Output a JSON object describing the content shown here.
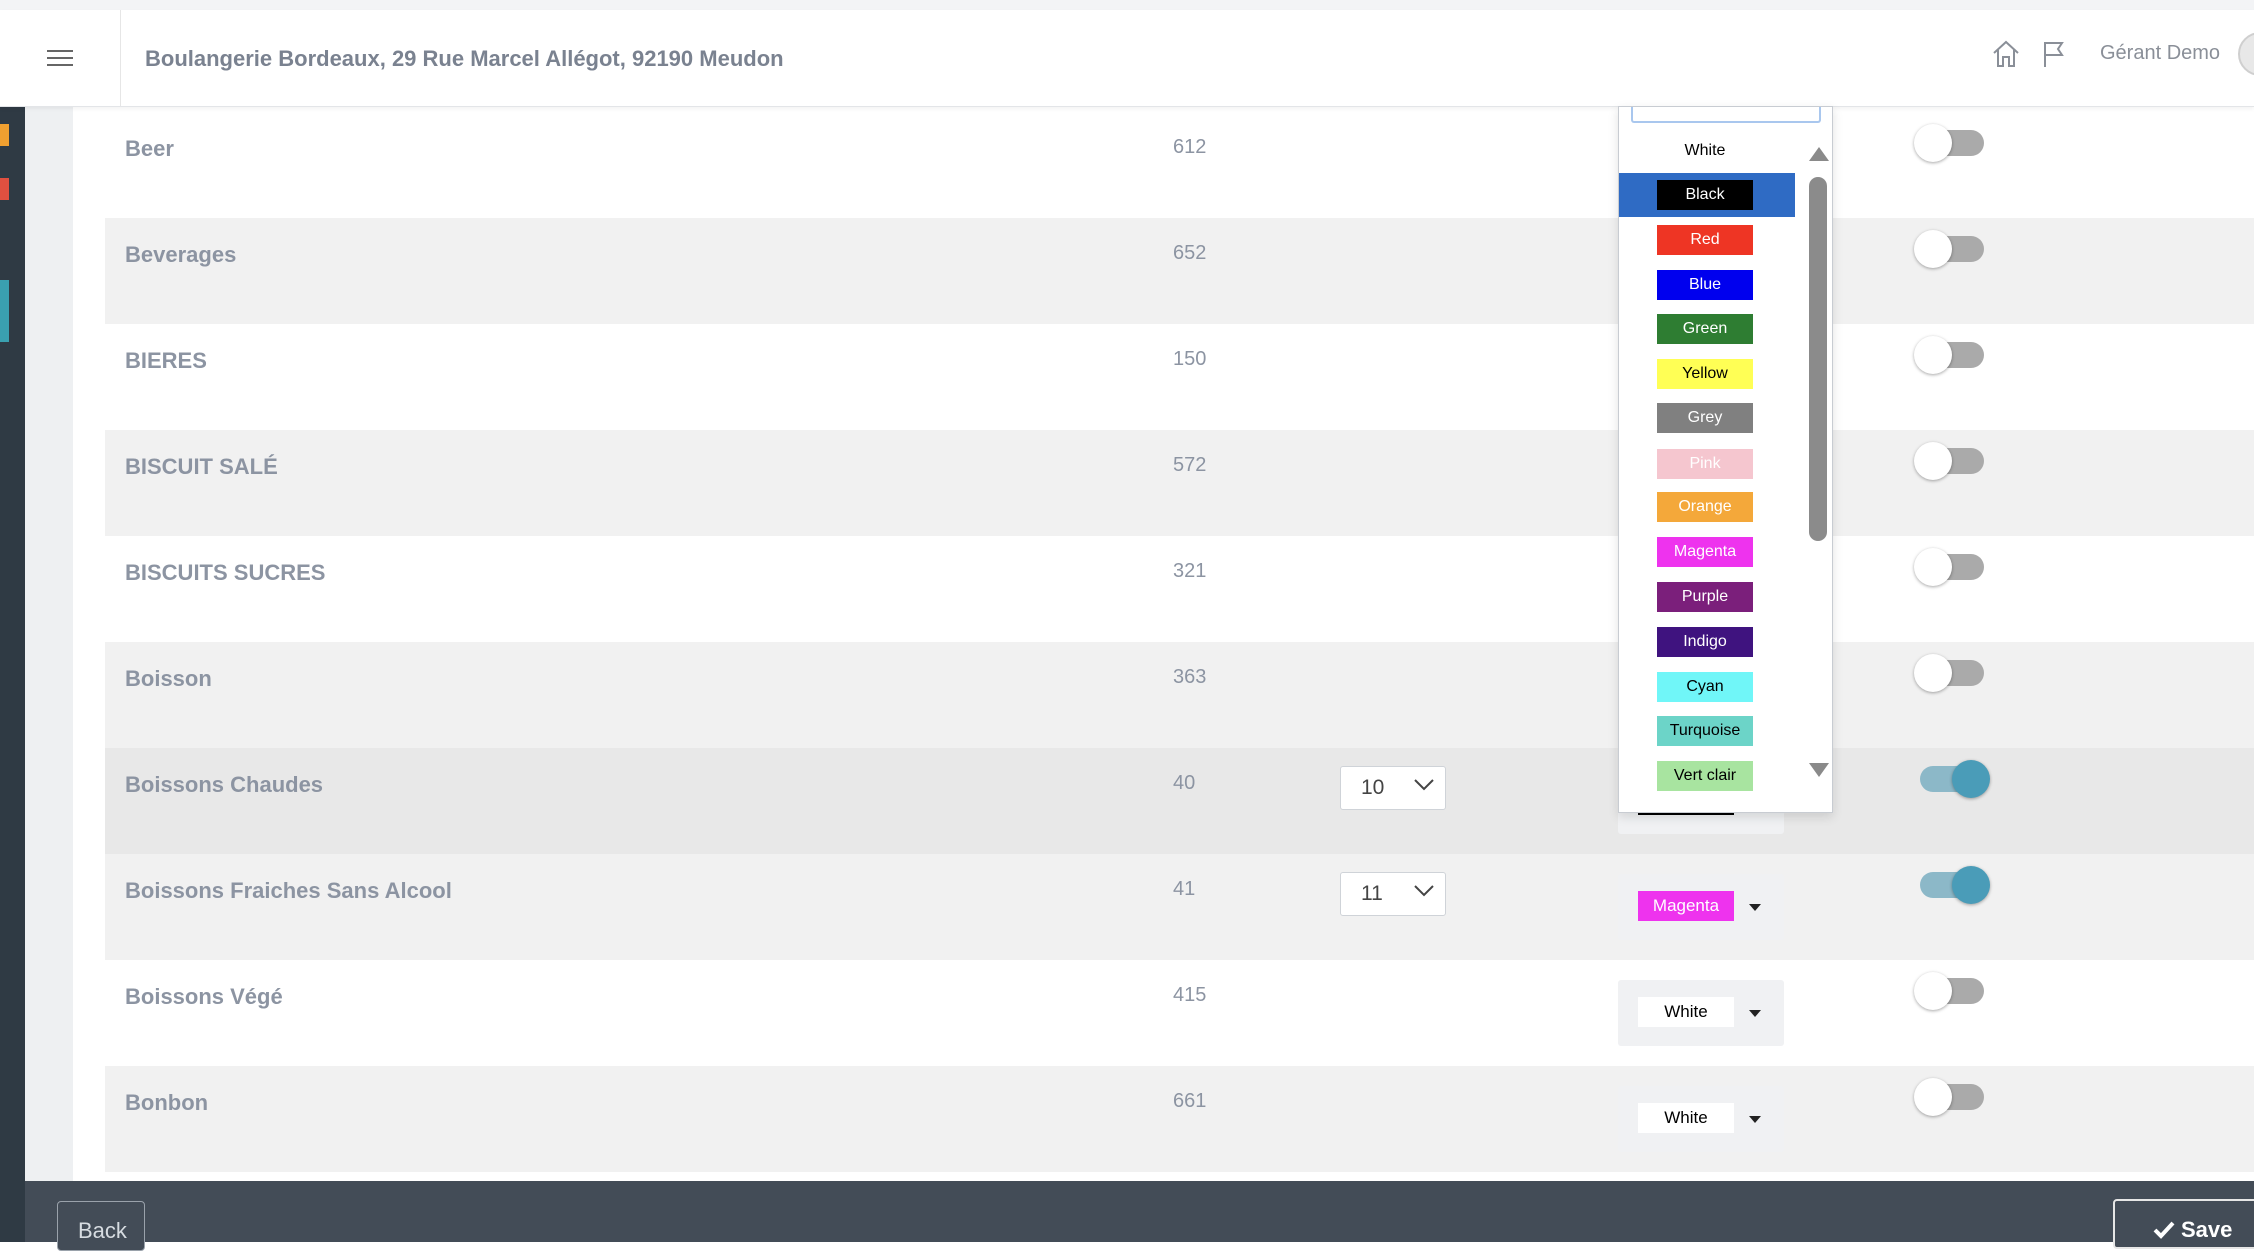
{
  "header": {
    "store_title": "Boulangerie Bordeaux, 29 Rue Marcel Allégot, 92190 Meudon",
    "user_name": "Gérant Demo"
  },
  "rows": [
    {
      "name": "Beer",
      "count": "612",
      "style": "white",
      "toggle": "off"
    },
    {
      "name": "Beverages",
      "count": "652",
      "style": "alt",
      "toggle": "off"
    },
    {
      "name": "BIERES",
      "count": "150",
      "style": "white",
      "toggle": "off"
    },
    {
      "name": "BISCUIT SALÉ",
      "count": "572",
      "style": "alt",
      "toggle": "off"
    },
    {
      "name": "BISCUITS SUCRES",
      "count": "321",
      "style": "white",
      "toggle": "off"
    },
    {
      "name": "Boisson",
      "count": "363",
      "style": "alt",
      "toggle": "off"
    },
    {
      "name": "Boissons Chaudes",
      "count": "40",
      "style": "hl",
      "position": "10",
      "color": "Black",
      "toggle": "on"
    },
    {
      "name": "Boissons Fraiches Sans Alcool",
      "count": "41",
      "style": "alt",
      "position": "11",
      "color": "Magenta",
      "toggle": "on"
    },
    {
      "name": "Boissons Végé",
      "count": "415",
      "style": "white",
      "color": "White",
      "toggle": "off"
    },
    {
      "name": "Bonbon",
      "count": "661",
      "style": "alt",
      "color": "White",
      "toggle": "off"
    }
  ],
  "color_dropdown": {
    "search_value": "",
    "selected": "Black",
    "options": [
      "White",
      "Black",
      "Red",
      "Blue",
      "Green",
      "Yellow",
      "Grey",
      "Pink",
      "Orange",
      "Magenta",
      "Purple",
      "Indigo",
      "Cyan",
      "Turquoise",
      "Vert clair"
    ]
  },
  "colors": {
    "White": {
      "bg": "#ffffff",
      "fg": "#000000"
    },
    "Black": {
      "bg": "#000000",
      "fg": "#ffffff"
    },
    "Red": {
      "bg": "#ee3524",
      "fg": "#ffffff"
    },
    "Blue": {
      "bg": "#0000ee",
      "fg": "#ffffff"
    },
    "Green": {
      "bg": "#2e7d32",
      "fg": "#ffffff"
    },
    "Yellow": {
      "bg": "#ffff55",
      "fg": "#000000"
    },
    "Grey": {
      "bg": "#808080",
      "fg": "#ffffff"
    },
    "Pink": {
      "bg": "#f5c6cf",
      "fg": "#ffffff"
    },
    "Orange": {
      "bg": "#f4a83a",
      "fg": "#ffffff"
    },
    "Magenta": {
      "bg": "#ee33ee",
      "fg": "#ffffff"
    },
    "Purple": {
      "bg": "#7b1f7b",
      "fg": "#ffffff"
    },
    "Indigo": {
      "bg": "#3f137f",
      "fg": "#ffffff"
    },
    "Cyan": {
      "bg": "#70f6f8",
      "fg": "#000000"
    },
    "Turquoise": {
      "bg": "#6cd4c8",
      "fg": "#000000"
    },
    "Vert clair": {
      "bg": "#a8e4a0",
      "fg": "#000000"
    }
  },
  "accents": {
    "sidebar": "#2f3a44",
    "footer": "#434c57",
    "toggle_on": "#4a9cb8",
    "selected_option": "#2f6bc4",
    "sidebar_marks": [
      "#f0a030",
      "#e05040",
      "#3aa0b0"
    ]
  },
  "footer": {
    "back_label": "Back",
    "save_label": "Save"
  }
}
